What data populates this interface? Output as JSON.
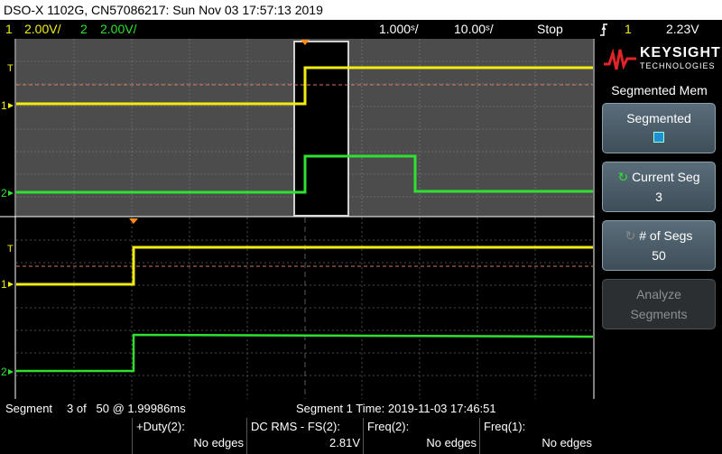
{
  "title": "DSO-X 1102G, CN57086217: Sun Nov 03 17:57:13 2019",
  "status": {
    "ch1_num": "1",
    "ch1_scale": "2.00V/",
    "ch2_num": "2",
    "ch2_scale": "2.00V/",
    "timebase1": "1.000ˢ/",
    "timebase2": "10.00ˢ/",
    "run_state": "Stop",
    "trigger_icon": "trigger-rising-edge-icon",
    "trigger_ch": "1",
    "trigger_level": "2.23V"
  },
  "markers": {
    "trig": "T",
    "ch1": "1",
    "ch2": "2"
  },
  "colors": {
    "ch1": "#f2ec13",
    "ch2": "#30e030",
    "grid_bg_top": "#4c4c4c",
    "marker": "#ff8c1a"
  },
  "logo": {
    "name": "KEYSIGHT",
    "sub": "TECHNOLOGIES"
  },
  "menu": {
    "title": "Segmented Mem",
    "softkeys": [
      {
        "l1": "Segmented",
        "l2": ""
      },
      {
        "l1": "Current Seg",
        "l2": "3"
      },
      {
        "l1": "# of Segs",
        "l2": "50"
      },
      {
        "l1": "Analyze",
        "l2": "Segments"
      }
    ]
  },
  "info": {
    "segment_label": "Segment",
    "segment_value": "3 of   50 @ 1.99986ms",
    "segment_time": "Segment 1 Time: 2019-11-03 17:46:51"
  },
  "measurements": [
    {
      "name": "+Duty(2):",
      "value": "No edges"
    },
    {
      "name": "DC RMS - FS(2):",
      "value": "2.81V"
    },
    {
      "name": "Freq(2):",
      "value": "No edges"
    },
    {
      "name": "Freq(1):",
      "value": "No edges"
    }
  ]
}
